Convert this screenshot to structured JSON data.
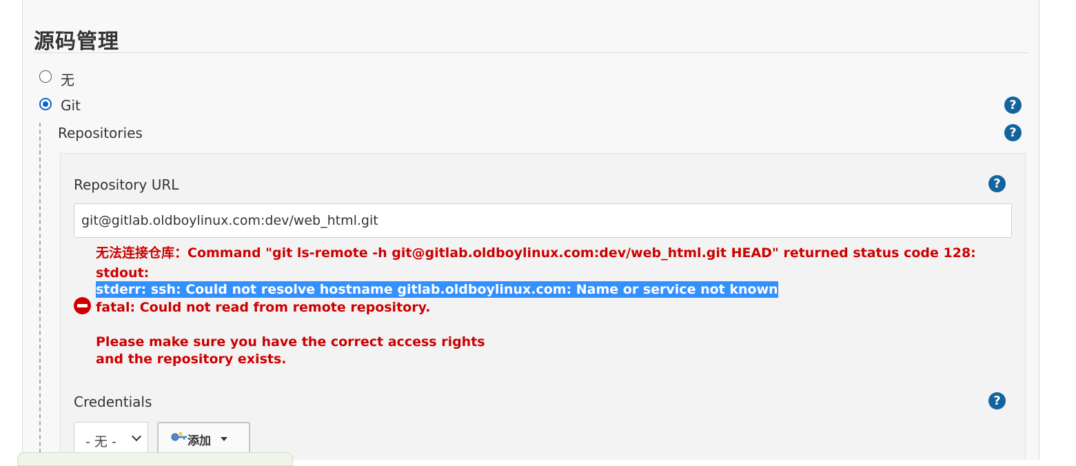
{
  "section": {
    "title": "源码管理"
  },
  "scm": {
    "options": [
      {
        "label": "无",
        "checked": false
      },
      {
        "label": "Git",
        "checked": true
      }
    ]
  },
  "git": {
    "repositories_label": "Repositories",
    "repository_url_label": "Repository URL",
    "repository_url_value": "git@gitlab.oldboylinux.com:dev/web_html.git",
    "error": {
      "line1": "无法连接仓库：Command \"git ls-remote -h git@gitlab.oldboylinux.com:dev/web_html.git HEAD\" returned status code 128:",
      "line2": "stdout:",
      "line3": "stderr: ssh: Could not resolve hostname gitlab.oldboylinux.com: Name or service not known",
      "line4": "fatal: Could not read from remote repository.",
      "line5": "Please make sure you have the correct access rights",
      "line6": "and the repository exists.",
      "color": "#cc0000",
      "selection_color": "#3390ff"
    },
    "credentials_label": "Credentials",
    "credentials_selected": "- 无 -",
    "add_button_label": "添加"
  },
  "help_icon_text": "?",
  "colors": {
    "help_icon": "#13639e",
    "radio_accent": "#0b64c8"
  }
}
